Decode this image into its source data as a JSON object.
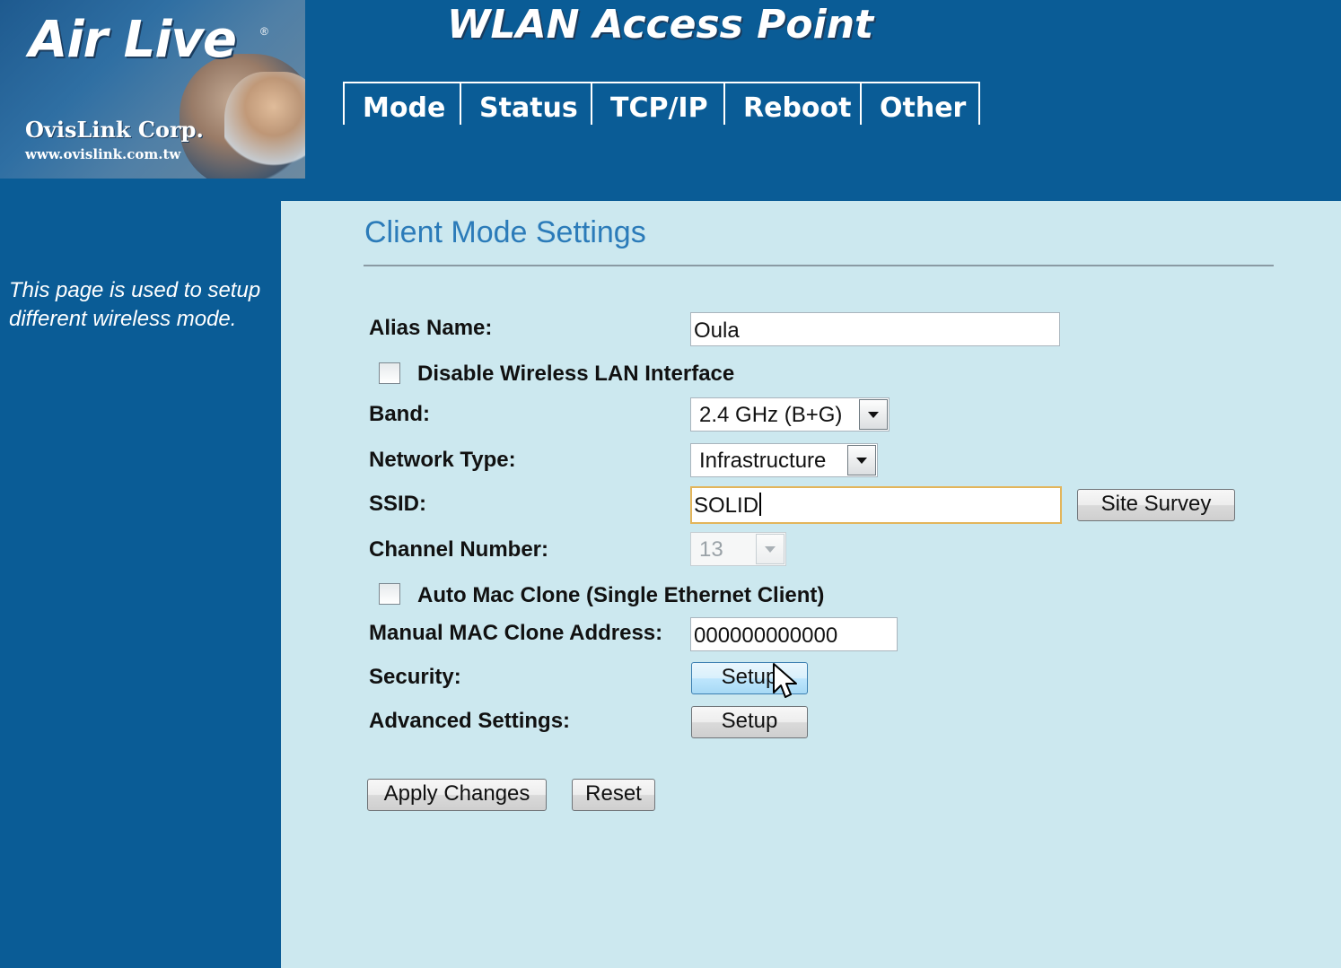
{
  "header": {
    "brand": "Air Live",
    "brand_mark": "®",
    "company": "OvisLink Corp.",
    "company_url": "www.ovislink.com.tw",
    "app_title": "WLAN Access Point"
  },
  "nav": {
    "tabs": [
      {
        "label": "Mode"
      },
      {
        "label": "Status"
      },
      {
        "label": "TCP/IP"
      },
      {
        "label": "Reboot"
      },
      {
        "label": "Other"
      }
    ]
  },
  "sidebar": {
    "help_text": "This page is used to setup different wireless mode."
  },
  "main": {
    "page_title": "Client Mode Settings",
    "alias_name": {
      "label": "Alias Name:",
      "value": "Oula"
    },
    "disable_wlan": {
      "label": "Disable Wireless LAN Interface",
      "checked": false
    },
    "band": {
      "label": "Band:",
      "selected": "2.4 GHz (B+G)"
    },
    "network_type": {
      "label": "Network Type:",
      "selected": "Infrastructure"
    },
    "ssid": {
      "label": "SSID:",
      "value": "SOLID",
      "site_survey_label": "Site Survey"
    },
    "channel_number": {
      "label": "Channel Number:",
      "selected": "13",
      "disabled": true
    },
    "auto_mac_clone": {
      "label": "Auto Mac Clone (Single Ethernet Client)",
      "checked": false
    },
    "manual_mac_clone": {
      "label": "Manual MAC Clone Address:",
      "value": "000000000000"
    },
    "security": {
      "label": "Security:",
      "button_label": "Setup"
    },
    "advanced": {
      "label": "Advanced Settings:",
      "button_label": "Setup"
    },
    "apply_label": "Apply Changes",
    "reset_label": "Reset"
  },
  "colors": {
    "header_bg": "#0a5c96",
    "content_bg": "#cce8ef",
    "title_color": "#2b7bb9",
    "focus_border": "#e3b55b"
  },
  "icons": {
    "dropdown": "chevron-down-icon",
    "pointer": "mouse-cursor-icon"
  }
}
